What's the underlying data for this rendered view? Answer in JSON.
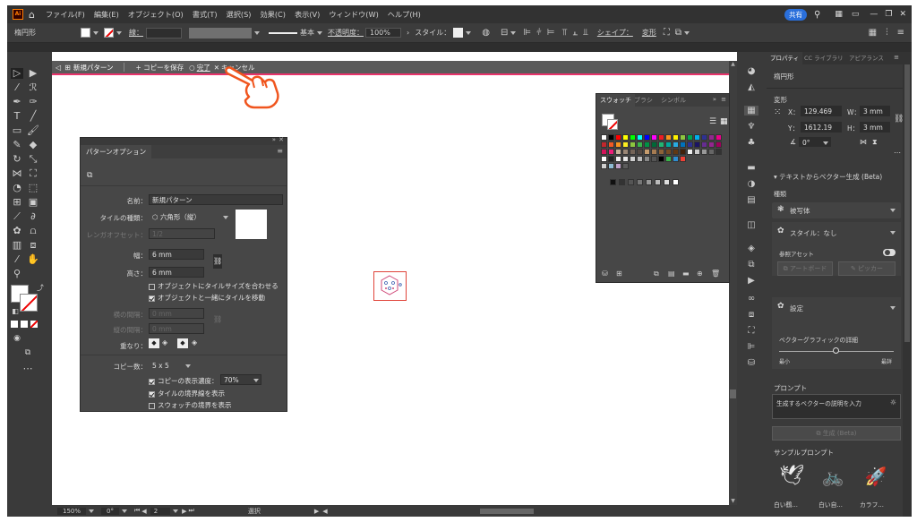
{
  "menu": {
    "items": [
      "ファイル(F)",
      "編集(E)",
      "オブジェクト(O)",
      "書式(T)",
      "選択(S)",
      "効果(C)",
      "表示(V)",
      "ウィンドウ(W)",
      "ヘルプ(H)"
    ],
    "share": "共有"
  },
  "control": {
    "object": "楕円形",
    "stroke": "線：",
    "stroke_style": "基本",
    "opacity_label": "不透明度：",
    "opacity": "100%",
    "style_label": "スタイル：",
    "shape": "シェイプ：",
    "transform": "変形"
  },
  "isolation": {
    "name": "新規パターン",
    "save_copy": "+ コピーを保存",
    "done": "完了",
    "cancel": "キャンセル"
  },
  "pattern_options": {
    "title": "パターンオプション",
    "name_label": "名前：",
    "name_value": "新規パターン",
    "tile_type_label": "タイルの種類：",
    "tile_type_value": "六角形（縦）",
    "offset_label": "レンガオフセット：",
    "offset_value": "1/2",
    "width_label": "幅：",
    "width_value": "6 mm",
    "height_label": "高さ：",
    "height_value": "6 mm",
    "fit_size": "オブジェクトにタイルサイズを合わせる",
    "move_tile": "オブジェクトと一緒にタイルを移動",
    "h_space_label": "横の間隔：",
    "h_space_value": "0 mm",
    "v_space_label": "縦の間隔：",
    "v_space_value": "0 mm",
    "overlap_label": "重なり：",
    "copies_label": "コピー数：",
    "copies_value": "5 x 5",
    "dim_copies": "コピーの表示濃度：",
    "dim_value": "70%",
    "show_tile_edge": "タイルの境界線を表示",
    "show_swatch_bounds": "スウォッチの境界を表示"
  },
  "swatches": {
    "tabs": [
      "スウォッチ",
      "ブラシ",
      "シンボル"
    ]
  },
  "properties": {
    "tabs": [
      "プロパティ",
      "CC ライブラリ",
      "アピアランス"
    ],
    "object": "楕円形",
    "transform": "変形",
    "x_label": "X：",
    "x_value": "129.469",
    "y_label": "Y：",
    "y_value": "1612.19",
    "w_label": "W：",
    "w_value": "3 mm",
    "h_label": "H：",
    "h_value": "3 mm",
    "angle": "0°",
    "text_to_vector": "テキストからベクター生成 (Beta)",
    "type_label": "種類",
    "type_value": "被写体",
    "style_value": "スタイル：なし",
    "ref_asset": "参照アセット",
    "artboard_btn": "アートボード",
    "pick_btn": "ピッカー",
    "settings": "設定",
    "detail": "ベクターグラフィックの詳細",
    "min": "最小",
    "max": "最詳",
    "prompt_label": "プロンプト",
    "prompt_placeholder": "生成するベクターの説明を入力",
    "generate": "生成 (Beta)",
    "sample": "サンプルプロンプト",
    "samples": [
      "白い鶴...",
      "白い自...",
      "カラフ..."
    ]
  },
  "status": {
    "zoom": "150%",
    "angle": "0°",
    "page": "2",
    "mode": "選択"
  },
  "colors": {
    "accent": "#e8336b",
    "hand": "#f0551e",
    "selection": "#e0443a"
  }
}
